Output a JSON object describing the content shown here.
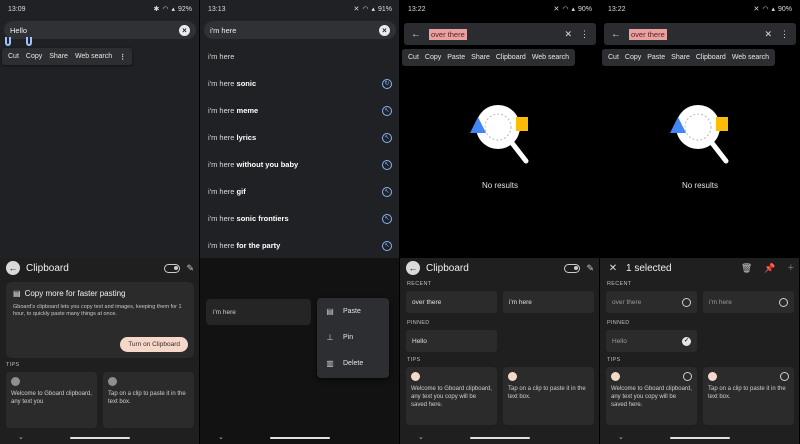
{
  "screens": [
    {
      "status": {
        "time": "13:09",
        "battery": "92%"
      },
      "search": {
        "query": "Hello"
      },
      "context_menu": [
        "Cut",
        "Copy",
        "Share",
        "Web search"
      ],
      "keyboard": {
        "title": "Clipboard",
        "promo": {
          "title": "Copy more for faster pasting",
          "body": "Gboard's clipboard lets you copy text and images, keeping them for 1 hour, to quickly paste many things at once.",
          "button": "Turn on Clipboard"
        },
        "tips_label": "TIPS",
        "tips": [
          "Welcome to Gboard clipboard, any text you",
          "Tap on a clip to paste it in the text box."
        ]
      }
    },
    {
      "status": {
        "time": "13:13",
        "battery": "91%"
      },
      "search": {
        "query": "i'm here"
      },
      "suggestions": [
        {
          "prefix": "i'm here",
          "bold": ""
        },
        {
          "prefix": "i'm here ",
          "bold": "sonic"
        },
        {
          "prefix": "i'm here ",
          "bold": "meme"
        },
        {
          "prefix": "i'm here ",
          "bold": "lyrics"
        },
        {
          "prefix": "i'm here ",
          "bold": "without you baby"
        },
        {
          "prefix": "i'm here ",
          "bold": "gif"
        },
        {
          "prefix": "i'm here ",
          "bold": "sonic frontiers"
        },
        {
          "prefix": "i'm here ",
          "bold": "for the party"
        }
      ],
      "clip": "i'm here",
      "popup": [
        "Paste",
        "Pin",
        "Delete"
      ]
    },
    {
      "status": {
        "time": "13:22",
        "battery": "90%"
      },
      "appbar": {
        "query": "over there"
      },
      "context_menu": [
        "Cut",
        "Copy",
        "Paste",
        "Share",
        "Clipboard",
        "Web search"
      ],
      "no_results": "No results",
      "keyboard": {
        "title": "Clipboard",
        "recent_label": "RECENT",
        "recent": [
          "over there",
          "i'm here"
        ],
        "pinned_label": "PINNED",
        "pinned": [
          "Hello"
        ],
        "tips_label": "TIPS",
        "tips": [
          "Welcome to Gboard clipboard, any text you copy will be saved here.",
          "Tap on a clip to paste it in the text box."
        ]
      }
    },
    {
      "status": {
        "time": "13:22",
        "battery": "90%"
      },
      "appbar": {
        "query": "over there"
      },
      "context_menu": [
        "Cut",
        "Copy",
        "Paste",
        "Share",
        "Clipboard",
        "Web search"
      ],
      "no_results": "No results",
      "keyboard": {
        "title": "1 selected",
        "recent_label": "RECENT",
        "recent": [
          "over there",
          "i'm here"
        ],
        "pinned_label": "PINNED",
        "pinned": [
          "Hello"
        ],
        "tips_label": "TIPS",
        "tips": [
          "Welcome to Gboard clipboard, any text you copy will be saved here.",
          "Tap on a clip to paste it in the text box."
        ]
      }
    }
  ]
}
